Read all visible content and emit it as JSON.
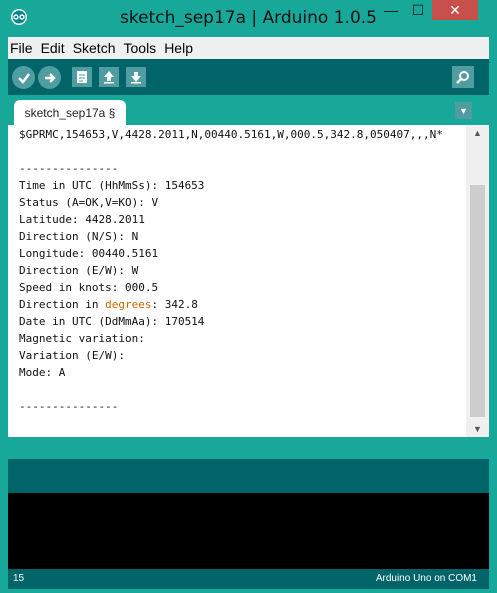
{
  "window": {
    "title": "sketch_sep17a | Arduino 1.0.5",
    "minimize_glyph": "—",
    "maximize_glyph": "☐",
    "close_glyph": "✕"
  },
  "menu": {
    "items": [
      "File",
      "Edit",
      "Sketch",
      "Tools",
      "Help"
    ]
  },
  "toolbar": {
    "buttons": [
      "verify-icon",
      "upload-icon",
      "new-icon",
      "open-icon",
      "save-icon"
    ],
    "serial_monitor": "serial-monitor-icon"
  },
  "tabs": {
    "active_label": "sketch_sep17a §",
    "menu_glyph": "▼"
  },
  "editor": {
    "lines": [
      "$GPRMC,154653,V,4428.2011,N,00440.5161,W,000.5,342.8,050407,,,N*",
      "",
      "---------------",
      "Time in UTC (HhMmSs): 154653",
      "Status (A=OK,V=KO): V",
      "Latitude: 4428.2011",
      "Direction (N/S): N",
      "Longitude: 00440.5161",
      "Direction (E/W): W",
      "Speed in knots: 000.5",
      "Direction in ",
      "Date in UTC (DdMmAa): 170514",
      "Magnetic variation:",
      "Variation (E/W):",
      "Mode: A",
      "",
      "---------------"
    ],
    "keyword": "degrees",
    "keyword_suffix": ": 342.8"
  },
  "scrollbar": {
    "up_glyph": "▲",
    "down_glyph": "▼"
  },
  "status": {
    "line_number": "15",
    "board": "Arduino Uno on COM1"
  },
  "colors": {
    "frame_teal": "#18a89a",
    "toolbar_dark_teal": "#006468",
    "button_teal": "#4f9da0",
    "close_red": "#c7504b",
    "keyword_orange": "#cc6600"
  }
}
